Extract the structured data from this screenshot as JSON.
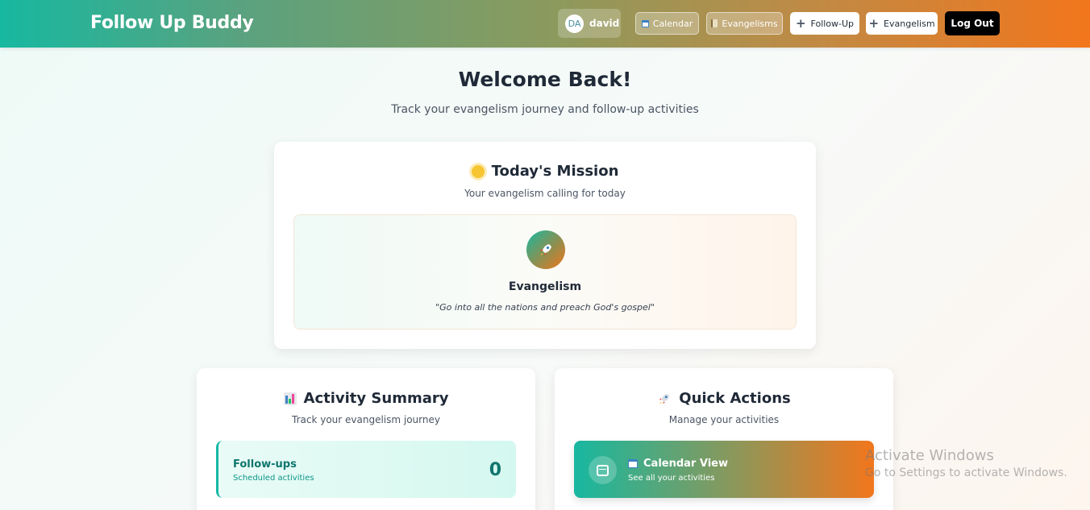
{
  "navbar": {
    "brand": "Follow Up Buddy",
    "user": {
      "initials": "DA",
      "name": "david"
    },
    "buttons": {
      "calendar": "Calendar",
      "evangelisms": "Evangelisms",
      "follow_up": "Follow-Up",
      "evangelism": "Evangelism",
      "logout": "Log Out"
    },
    "colors": {
      "gradient_start": "#17b8a0",
      "gradient_end": "#f2761c"
    }
  },
  "welcome": {
    "title": "Welcome Back!",
    "subtitle": "Track your evangelism journey and follow-up activities"
  },
  "mission": {
    "icon": "sun-icon",
    "title": "Today's Mission",
    "subtitle": "Your evangelism calling for today",
    "item": {
      "icon": "rocket-icon",
      "name": "Evangelism",
      "quote": "\"Go into all the nations and preach God's gospel\""
    }
  },
  "summary": {
    "icon": "bar-chart-icon",
    "title": "Activity Summary",
    "subtitle": "Track your evangelism journey",
    "stats": [
      {
        "label": "Follow-ups",
        "sub": "Scheduled activities",
        "value": "0"
      }
    ]
  },
  "actions": {
    "icon": "rocket-icon",
    "title": "Quick Actions",
    "subtitle": "Manage your activities",
    "items": [
      {
        "icon": "calendar-icon",
        "title": "Calendar View",
        "sub": "See all your activities"
      }
    ]
  },
  "watermark": {
    "title": "Activate Windows",
    "subtitle": "Go to Settings to activate Windows."
  }
}
